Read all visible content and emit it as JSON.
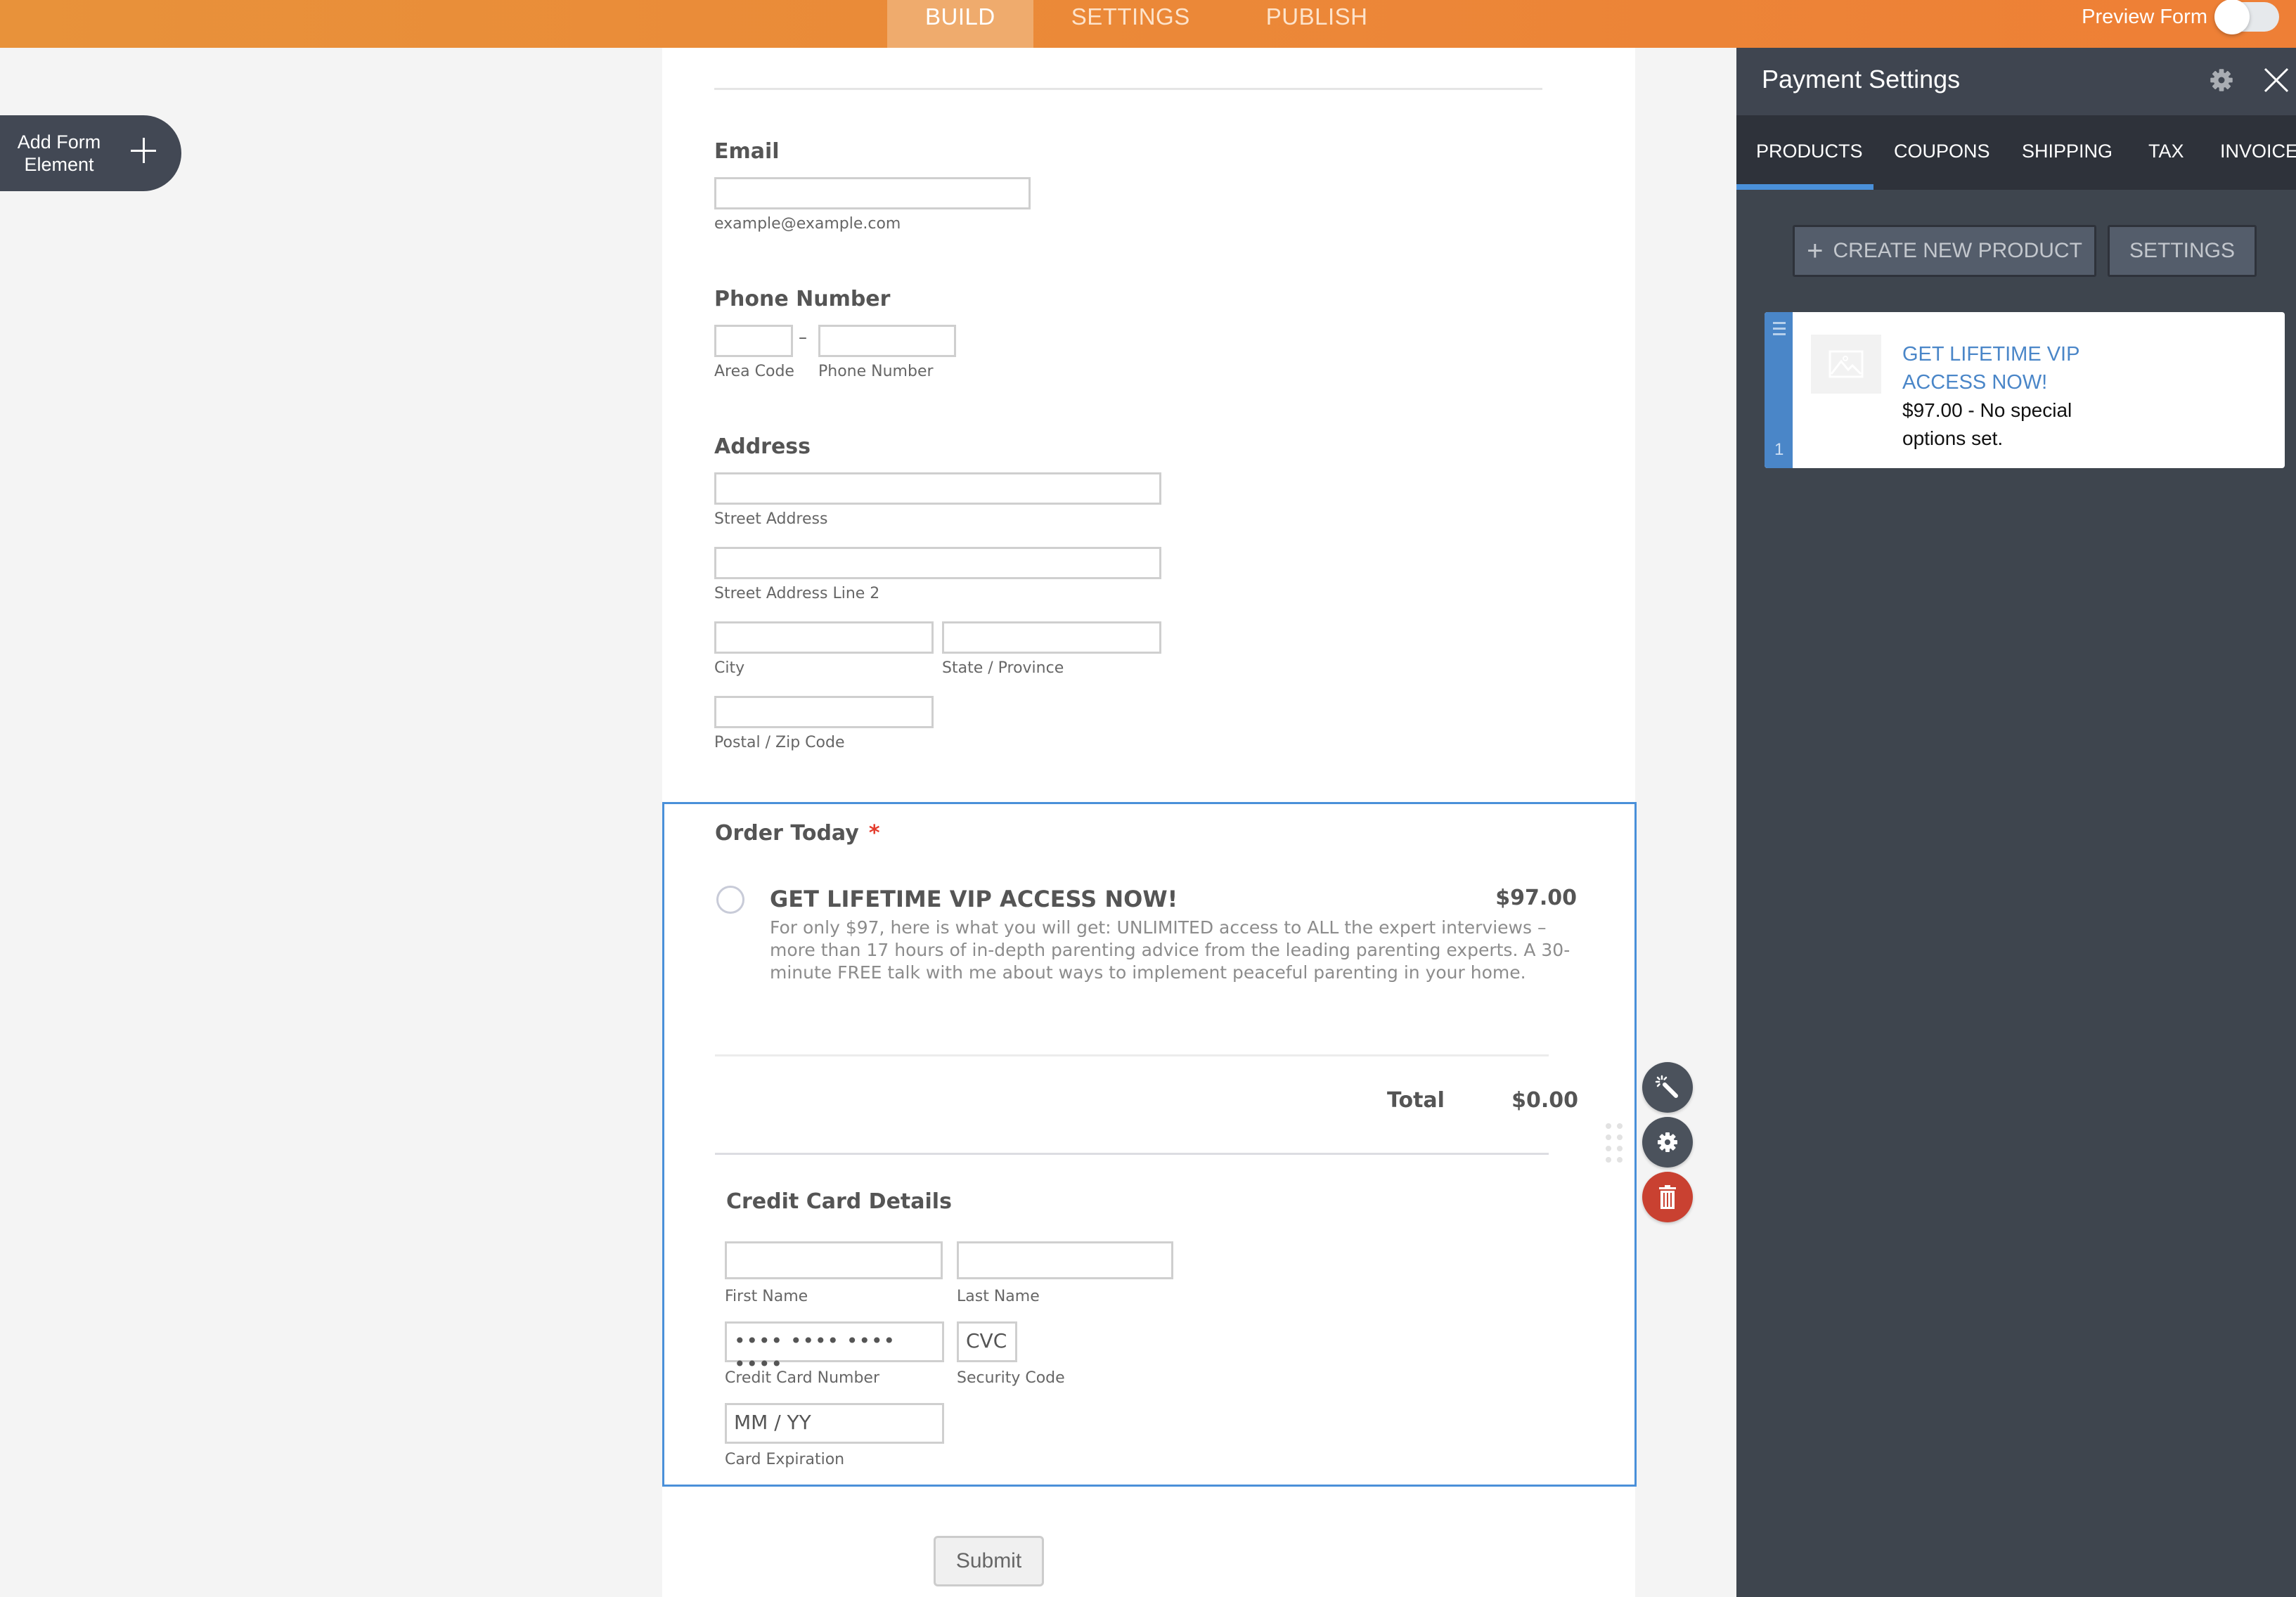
{
  "topbar": {
    "tabs": [
      {
        "label": "BUILD",
        "active": true
      },
      {
        "label": "SETTINGS",
        "active": false
      },
      {
        "label": "PUBLISH",
        "active": false
      }
    ],
    "preview_label": "Preview Form",
    "preview_on": false
  },
  "add_element": {
    "label": "Add Form Element"
  },
  "form": {
    "email": {
      "label": "Email",
      "value": "",
      "sublabel": "example@example.com"
    },
    "phone": {
      "label": "Phone Number",
      "separator": "–",
      "area_code_label": "Area Code",
      "number_label": "Phone Number"
    },
    "address": {
      "label": "Address",
      "street_label": "Street Address",
      "street2_label": "Street Address Line 2",
      "city_label": "City",
      "state_label": "State / Province",
      "zip_label": "Postal / Zip Code"
    },
    "order": {
      "label": "Order Today",
      "required_mark": "*",
      "product_name": "GET LIFETIME VIP ACCESS NOW!",
      "product_price": "$97.00",
      "product_desc": "For only $97, here is what you will get: UNLIMITED access to ALL the expert interviews – more than 17 hours of in-depth parenting advice from the leading parenting experts. A 30-minute FREE talk with me about ways to implement peaceful parenting in your home.",
      "total_label": "Total",
      "total_value": "$0.00",
      "cc": {
        "title": "Credit Card Details",
        "first_name_label": "First Name",
        "last_name_label": "Last Name",
        "number_placeholder": "•••• •••• •••• ••••",
        "number_label": "Credit Card Number",
        "cvc_placeholder": "CVC",
        "cvc_label": "Security Code",
        "exp_placeholder": "MM / YY",
        "exp_label": "Card Expiration"
      }
    },
    "submit_label": "Submit"
  },
  "element_actions": {
    "wand": "wand-icon",
    "settings": "gear-icon",
    "delete": "trash-icon",
    "delete_color": "#c94131"
  },
  "panel": {
    "title": "Payment Settings",
    "tabs": [
      {
        "label": "PRODUCTS",
        "active": true
      },
      {
        "label": "COUPONS",
        "active": false
      },
      {
        "label": "SHIPPING",
        "active": false
      },
      {
        "label": "TAX",
        "active": false
      },
      {
        "label": "INVOICE",
        "active": false
      }
    ],
    "create_label": "CREATE NEW PRODUCT",
    "settings_label": "SETTINGS",
    "products": [
      {
        "index": "1",
        "title": "GET LIFETIME VIP ACCESS NOW!",
        "desc": "$97.00 - No special options set."
      }
    ]
  },
  "colors": {
    "brand_orange": "#ee8a38",
    "accent_blue": "#4a90d9",
    "panel_bg": "#3e454e"
  }
}
